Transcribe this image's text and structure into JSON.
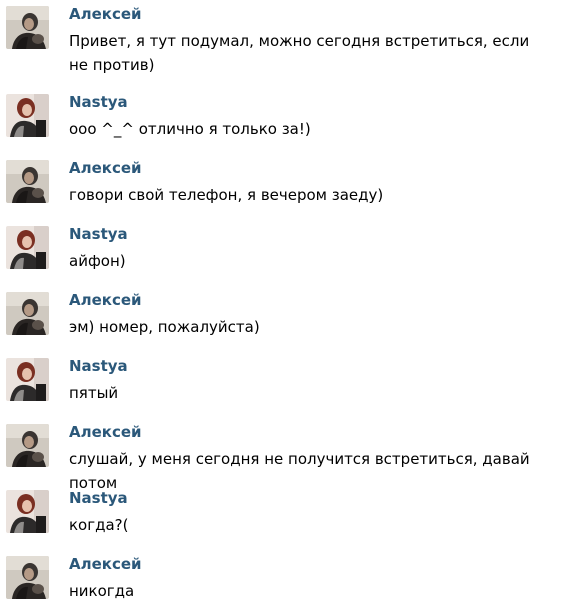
{
  "colors": {
    "author_name": "#2b587a",
    "message_text": "#000000",
    "background": "#ffffff"
  },
  "messages": [
    {
      "author": "Алексей",
      "text": "Привет, я тут подумал, можно сегодня встретиться, если не против)",
      "avatar": "alexey-avatar-photo"
    },
    {
      "author": "Nastya",
      "text": "ооо ^_^ отлично я только за!)",
      "avatar": "nastya-avatar-photo"
    },
    {
      "author": "Алексей",
      "text": "говори свой телефон, я вечером заеду)",
      "avatar": "alexey-avatar-photo"
    },
    {
      "author": "Nastya",
      "text": "айфон)",
      "avatar": "nastya-avatar-photo"
    },
    {
      "author": "Алексей",
      "text": "эм) номер, пожалуйста)",
      "avatar": "alexey-avatar-photo"
    },
    {
      "author": "Nastya",
      "text": "пятый",
      "avatar": "nastya-avatar-photo"
    },
    {
      "author": "Алексей",
      "text": "слушай, у меня сегодня не получится встретиться, давай потом",
      "avatar": "alexey-avatar-photo"
    },
    {
      "author": "Nastya",
      "text": "когда?(",
      "avatar": "nastya-avatar-photo"
    },
    {
      "author": "Алексей",
      "text": "никогда",
      "avatar": "alexey-avatar-photo"
    }
  ]
}
